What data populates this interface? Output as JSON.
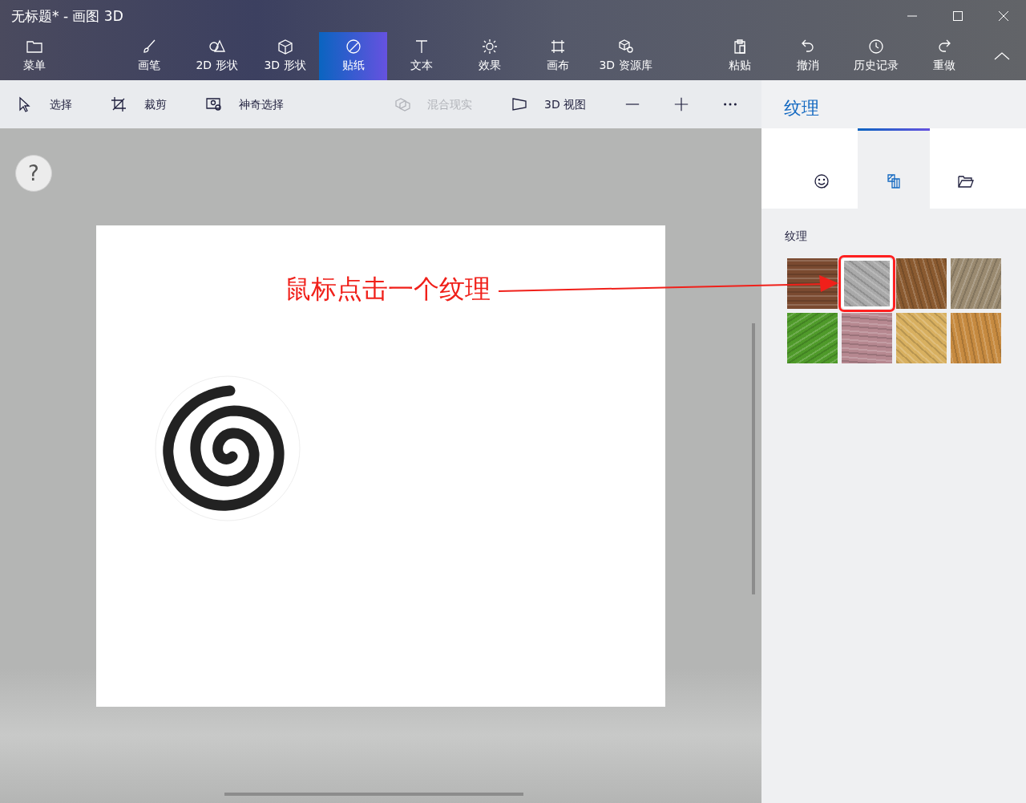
{
  "window": {
    "title": "无标题* - 画图 3D"
  },
  "ribbon": {
    "left": [
      {
        "label": "菜单",
        "selected": false
      }
    ],
    "tools": [
      {
        "label": "画笔",
        "selected": false
      },
      {
        "label": "2D 形状",
        "selected": false
      },
      {
        "label": "3D 形状",
        "selected": false
      },
      {
        "label": "贴纸",
        "selected": true
      },
      {
        "label": "文本",
        "selected": false
      },
      {
        "label": "效果",
        "selected": false
      },
      {
        "label": "画布",
        "selected": false
      },
      {
        "label": "3D 资源库",
        "selected": false
      }
    ],
    "actions": [
      {
        "label": "粘贴"
      },
      {
        "label": "撤消"
      },
      {
        "label": "历史记录"
      },
      {
        "label": "重做"
      }
    ]
  },
  "toolbar": [
    {
      "label": "选择",
      "disabled": false
    },
    {
      "label": "裁剪",
      "disabled": false
    },
    {
      "label": "神奇选择",
      "disabled": false
    },
    {
      "label": "混合现实",
      "disabled": true
    },
    {
      "label": "3D 视图",
      "disabled": false
    }
  ],
  "help": {
    "label": "?"
  },
  "annotation": {
    "text": "鼠标点击一个纹理"
  },
  "panel": {
    "title": "纹理",
    "tabs": [
      {
        "selected": false
      },
      {
        "selected": true
      },
      {
        "selected": false
      }
    ],
    "section": "纹理",
    "textures": [
      {
        "color": "#7a4a30",
        "selected": false
      },
      {
        "color": "#a9a9a9",
        "selected": true
      },
      {
        "color": "#8a5a30",
        "selected": false
      },
      {
        "color": "#9a8a70",
        "selected": false
      },
      {
        "color": "#4f9a2a",
        "selected": false
      },
      {
        "color": "#b68890",
        "selected": false
      },
      {
        "color": "#d8b060",
        "selected": false
      },
      {
        "color": "#c68a40",
        "selected": false
      }
    ]
  }
}
